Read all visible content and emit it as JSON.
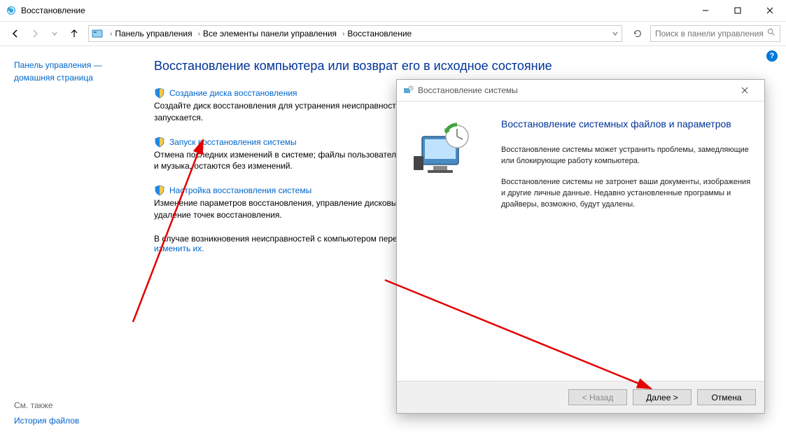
{
  "window": {
    "title": "Восстановление"
  },
  "window_controls": {
    "minimize": "—",
    "maximize": "☐",
    "close": "✕"
  },
  "breadcrumb": {
    "items": [
      "Панель управления",
      "Все элементы панели управления",
      "Восстановление"
    ]
  },
  "search": {
    "placeholder": "Поиск в панели управления"
  },
  "sidebar": {
    "link": "Панель управления — домашняя страница"
  },
  "page": {
    "title": "Восстановление компьютера или возврат его в исходное состояние",
    "options": [
      {
        "link": "Создание диска восстановления",
        "desc": "Создайте диск восстановления для устранения неисправностей компьютера, даже если он не запускается."
      },
      {
        "link": "Запуск восстановления системы",
        "desc": "Отмена последних изменений в системе; файлы пользователя, такие как документы, изображения и музыка, остаются без изменений."
      },
      {
        "link": "Настройка восстановления системы",
        "desc": "Изменение параметров восстановления, управление дисковым пространством и создание или удаление точек восстановления."
      }
    ],
    "troubleshoot_prefix": "В случае возникновения неисправностей с компьютером перейдите к его параметрам и попробуйте ",
    "troubleshoot_link": "изменить их."
  },
  "see_also": {
    "title": "См. также",
    "link": "История файлов"
  },
  "help": "?",
  "dialog": {
    "title": "Восстановление системы",
    "heading": "Восстановление системных файлов и параметров",
    "para1": "Восстановление системы может устранить проблемы, замедляющие или блокирующие работу компьютера.",
    "para2": "Восстановление системы не затронет ваши документы, изображения и другие личные данные. Недавно установленные программы и драйверы, возможно, будут удалены.",
    "back": "< Назад",
    "next": "Далее >",
    "cancel": "Отмена"
  }
}
